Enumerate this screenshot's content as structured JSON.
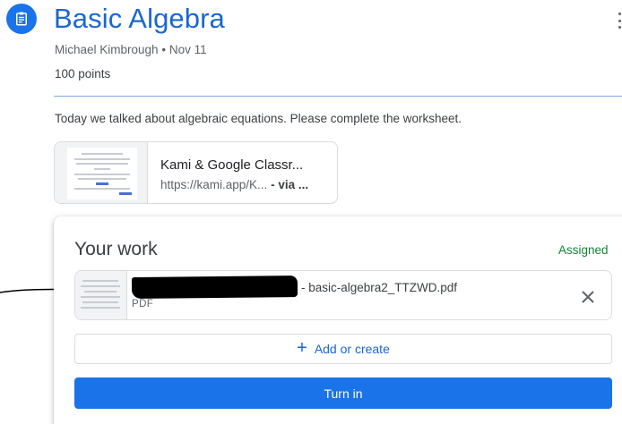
{
  "assignment": {
    "icon": "assignment-icon",
    "title": "Basic Algebra",
    "author": "Michael Kimbrough",
    "separator": "•",
    "date": "Nov 11",
    "points": "100 points",
    "description": "Today we talked about algebraic equations.  Please complete the worksheet."
  },
  "attachment": {
    "title": "Kami & Google Classr...",
    "url": "https://kami.app/K...",
    "via": "- via ..."
  },
  "your_work": {
    "heading": "Your work",
    "status": "Assigned",
    "status_color": "#188038",
    "file": {
      "name": "- basic-algebra2_TTZWD.pdf",
      "type": "PDF",
      "remove_icon": "close-icon"
    },
    "add_label": "Add or create",
    "add_icon": "plus-icon",
    "turn_in_label": "Turn in"
  },
  "colors": {
    "accent": "#1a73e8",
    "title": "#1967d2"
  }
}
